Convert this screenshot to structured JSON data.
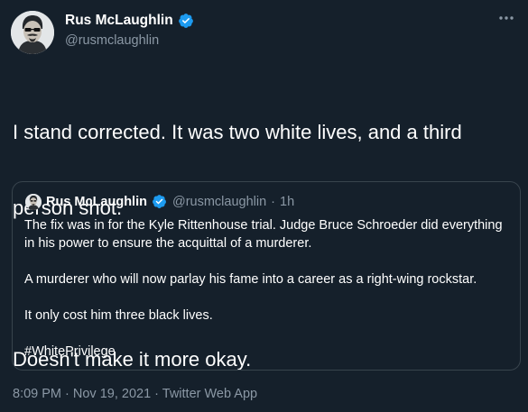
{
  "tweet": {
    "author": {
      "display_name": "Rus McLaughlin",
      "handle": "@rusmclaughlin",
      "verified": true
    },
    "text_lines": [
      "I stand corrected. It was two white lives, and a third",
      "person shot.",
      "",
      "Doesn't make it more okay."
    ],
    "timestamp": "8:09 PM · Nov 19, 2021 · Twitter Web App",
    "more_icon": "more-horizontal-icon"
  },
  "quote": {
    "author": {
      "display_name": "Rus McLaughlin",
      "handle": "@rusmclaughlin",
      "separator": "·",
      "age": "1h",
      "verified": true
    },
    "paragraphs": [
      "The fix was in for the Kyle Rittenhouse trial. Judge Bruce Schroeder did everything in his power to ensure the acquittal of a murderer.",
      "A murderer who will now parlay his fame into a career as a right-wing rockstar.",
      "It only cost him three black lives.",
      "#WhitePrivilege"
    ]
  },
  "colors": {
    "background": "#15202b",
    "text": "#ffffff",
    "secondary_text": "#8b98a5",
    "border": "#38444d",
    "verified_badge": "#1d9bf0"
  }
}
